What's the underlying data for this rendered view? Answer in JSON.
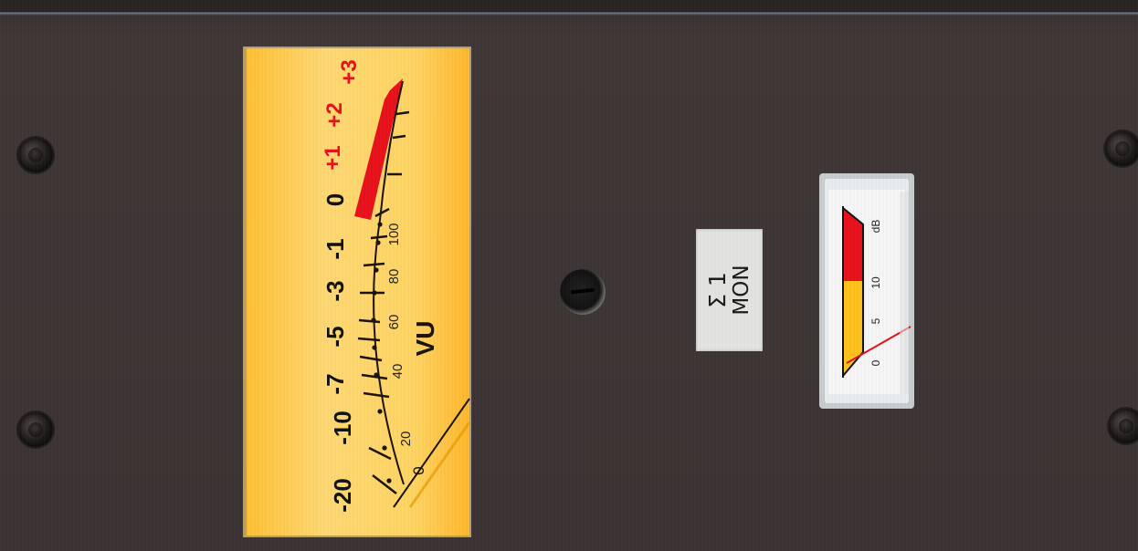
{
  "vu_meter": {
    "scale_labels_black": [
      "-20",
      "-10",
      "-7",
      "-5",
      "-3",
      "-1",
      "0"
    ],
    "scale_labels_red": [
      "+1",
      "+2",
      "+3"
    ],
    "percent_labels": [
      "20",
      "40",
      "60",
      "80",
      "100"
    ],
    "unit_label": "VU",
    "pivot_label": "0",
    "face_color": "#ffc53a",
    "red_zone_color": "#e8101a"
  },
  "channel_label": {
    "line1": "Σ 1",
    "line2": "MON"
  },
  "small_meter": {
    "scale_labels": [
      "0",
      "5",
      "10",
      "dB"
    ],
    "red_color": "#e8101a",
    "yellow_color": "#ffc21a",
    "needle_level": 0.05
  }
}
